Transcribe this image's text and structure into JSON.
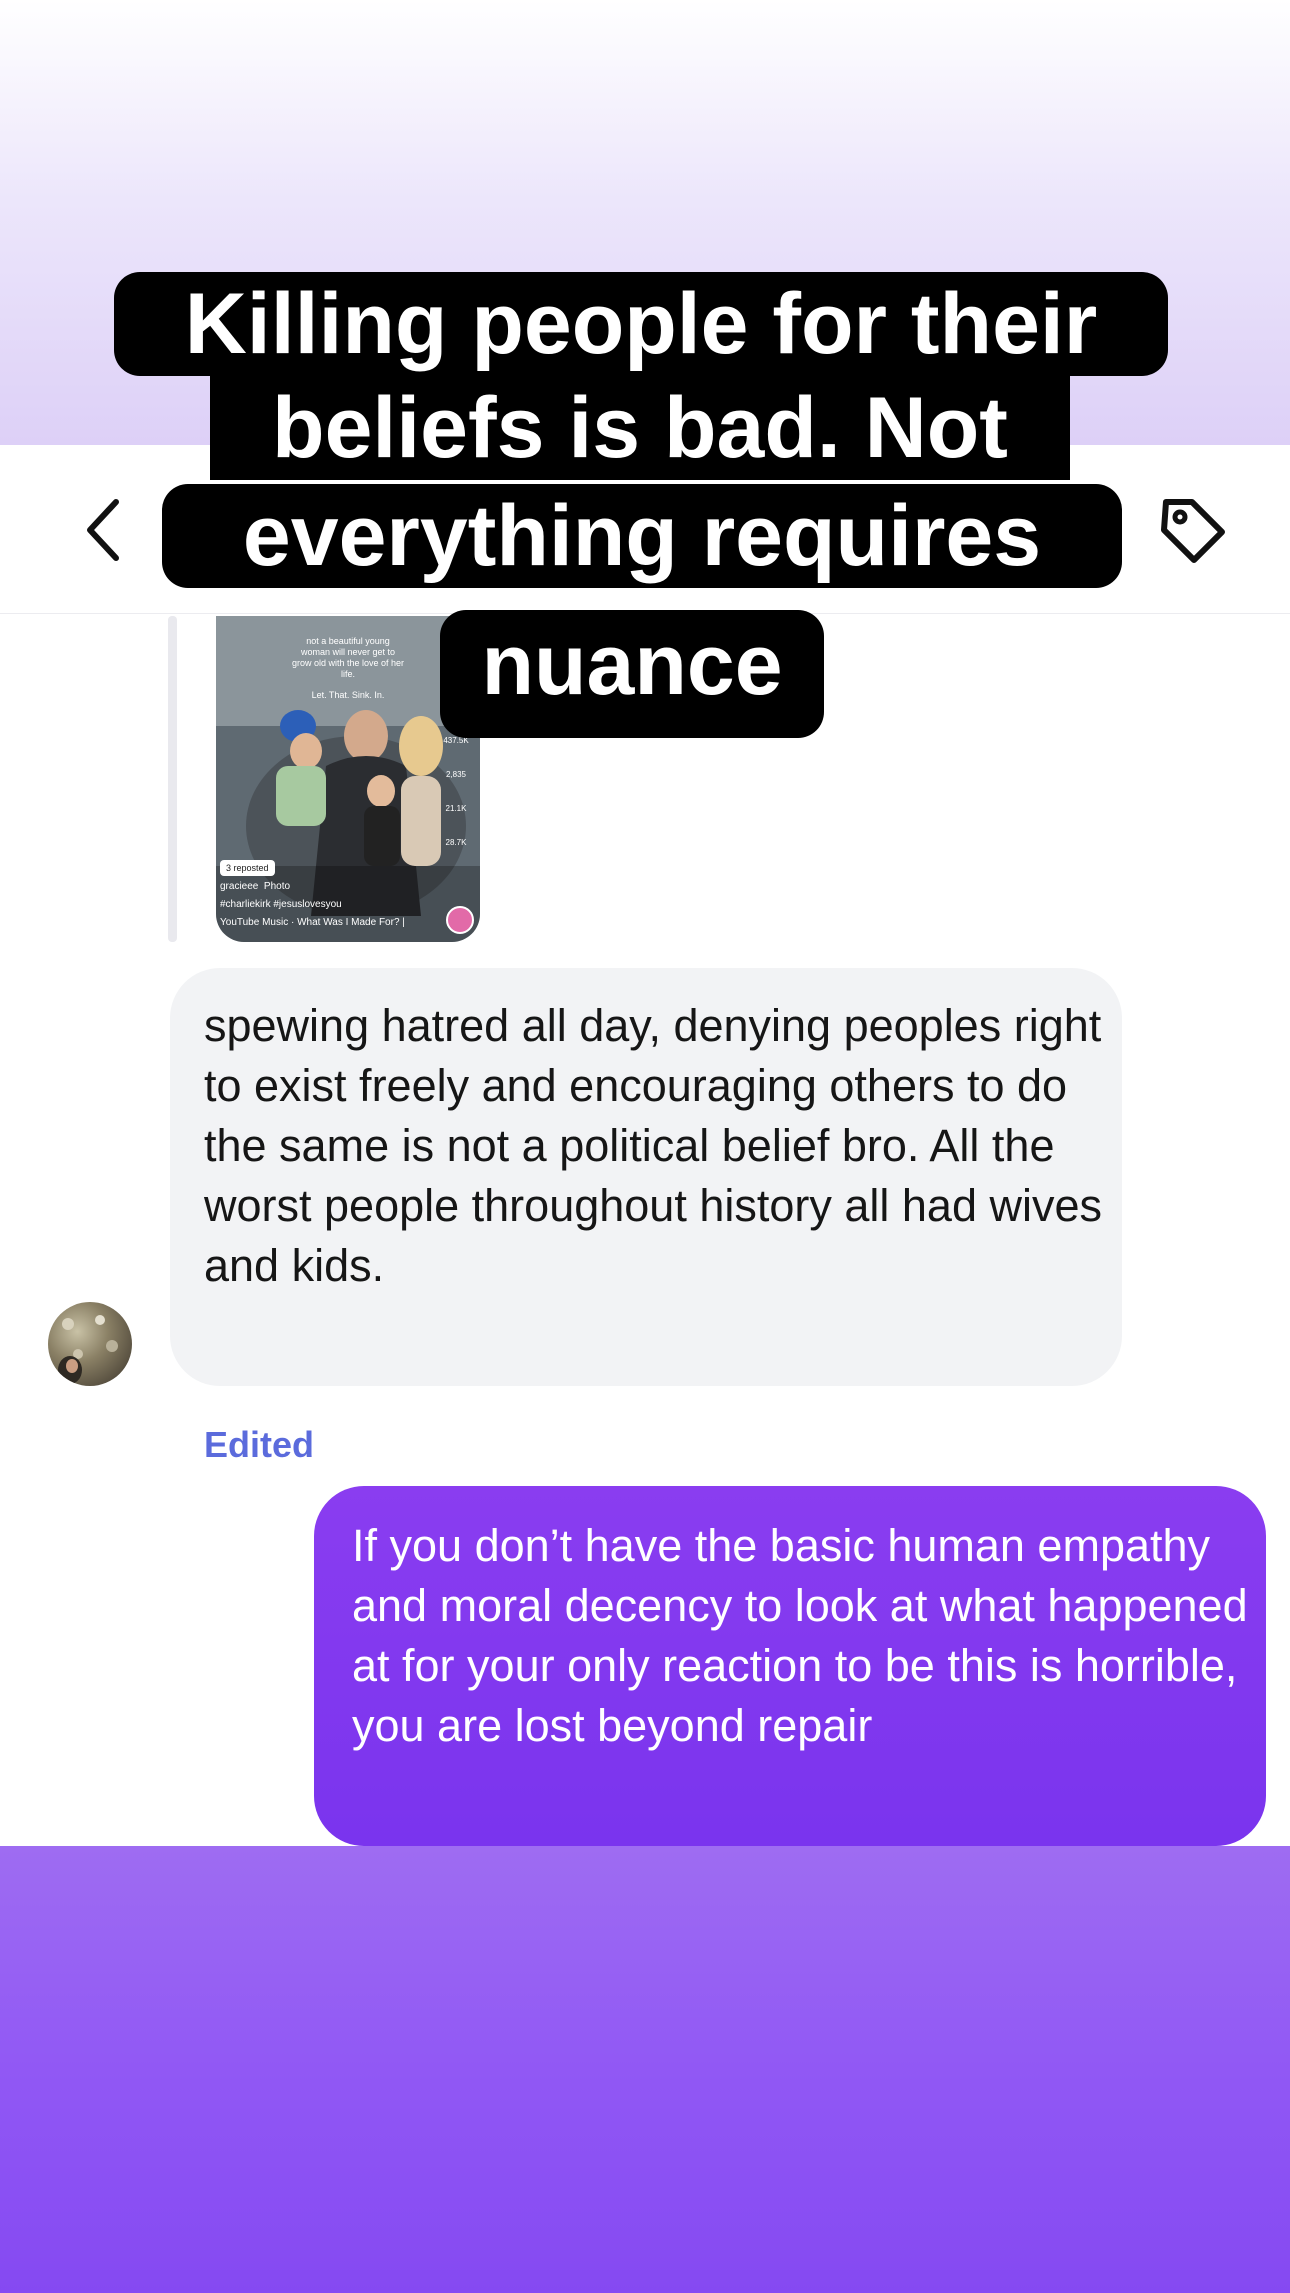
{
  "caption_banner": {
    "lines": [
      "Killing people for their",
      "beliefs is bad. Not",
      "everything requires",
      "nuance"
    ]
  },
  "header": {
    "back_icon": "chevron-left-icon",
    "tag_icon": "tag-icon"
  },
  "shared_post": {
    "caption_lines": [
      "not a beautiful young",
      "woman will never get to",
      "grow old with the love of her",
      "life."
    ],
    "tagline": "Let. That. Sink. In.",
    "repost_label": "3 reposted",
    "username": "gracieee",
    "post_type": "Photo",
    "hashtags": "#charliekirk #jesuslovesyou",
    "music": "YouTube Music · What Was I Made For? |",
    "likes": "437.5K",
    "comments": "2,835",
    "saves": "21.1K",
    "shares": "28.7K"
  },
  "messages": [
    {
      "direction": "incoming",
      "text": "spewing hatred all day, denying peoples right to exist freely and encouraging others to do the same is not a political belief bro. All the worst people throughout history all had wives and kids."
    },
    {
      "direction": "outgoing",
      "status": "Edited",
      "text": "If you don’t have the basic human empathy and moral decency to look  at what happened at for your only reaction to be this is horrible, you are lost beyond repair"
    }
  ],
  "colors": {
    "outgoing_bubble": "#7a34ee",
    "incoming_bubble": "#f2f3f5",
    "edited_label": "#5b6bdc",
    "banner_background": "#000000"
  }
}
